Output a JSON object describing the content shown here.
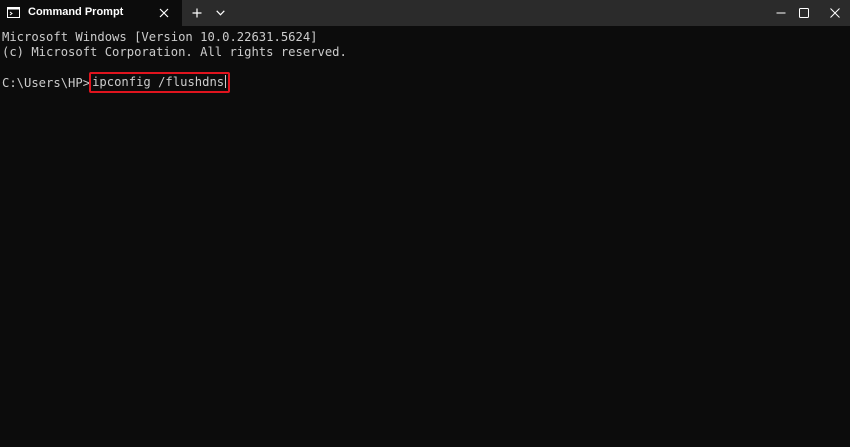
{
  "window": {
    "tab_title": "Command Prompt",
    "accent_color": "#e0141e",
    "background_color": "#0c0c0c",
    "text_color": "#cccccc"
  },
  "icons": {
    "tab_icon": "terminal-icon",
    "tab_close": "close-icon",
    "new_tab": "plus-icon",
    "dropdown": "chevron-down-icon",
    "minimize": "minimize-icon",
    "maximize": "maximize-icon",
    "close": "close-icon"
  },
  "terminal": {
    "lines": [
      "Microsoft Windows [Version 10.0.22631.5624]",
      "(c) Microsoft Corporation. All rights reserved."
    ],
    "prompt": "C:\\Users\\HP>",
    "command": "ipconfig /flushdns"
  }
}
